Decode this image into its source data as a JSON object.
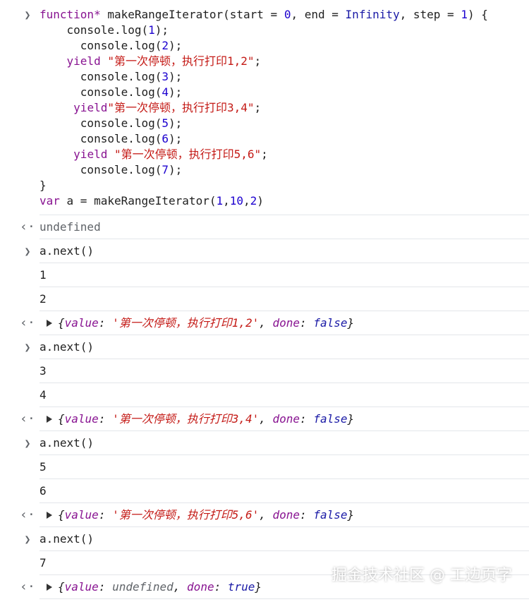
{
  "input1": {
    "lines": [
      {
        "indent": "",
        "parts": [
          [
            "kw",
            "function*"
          ],
          [
            "op",
            " "
          ],
          [
            "fn",
            "makeRangeIterator"
          ],
          [
            "op",
            "("
          ],
          [
            "param",
            "start"
          ],
          [
            "op",
            " = "
          ],
          [
            "num",
            "0"
          ],
          [
            "op",
            ", "
          ],
          [
            "param",
            "end"
          ],
          [
            "op",
            " = "
          ],
          [
            "kw-blue",
            "Infinity"
          ],
          [
            "op",
            ", "
          ],
          [
            "param",
            "step"
          ],
          [
            "op",
            " = "
          ],
          [
            "num",
            "1"
          ],
          [
            "op",
            ") {"
          ]
        ]
      },
      {
        "indent": "    ",
        "parts": [
          [
            "op",
            "console.log("
          ],
          [
            "num",
            "1"
          ],
          [
            "op",
            ");"
          ]
        ]
      },
      {
        "indent": "      ",
        "parts": [
          [
            "op",
            "console.log("
          ],
          [
            "num",
            "2"
          ],
          [
            "op",
            ");"
          ]
        ]
      },
      {
        "indent": "    ",
        "parts": [
          [
            "kw",
            "yield"
          ],
          [
            "op",
            " "
          ],
          [
            "str",
            "\"第一次停顿，执行打印1,2\""
          ],
          [
            "op",
            ";"
          ]
        ]
      },
      {
        "indent": "      ",
        "parts": [
          [
            "op",
            "console.log("
          ],
          [
            "num",
            "3"
          ],
          [
            "op",
            ");"
          ]
        ]
      },
      {
        "indent": "      ",
        "parts": [
          [
            "op",
            "console.log("
          ],
          [
            "num",
            "4"
          ],
          [
            "op",
            ");"
          ]
        ]
      },
      {
        "indent": "     ",
        "parts": [
          [
            "kw",
            "yield"
          ],
          [
            "str",
            "\"第一次停顿，执行打印3,4\""
          ],
          [
            "op",
            ";"
          ]
        ]
      },
      {
        "indent": "      ",
        "parts": [
          [
            "op",
            "console.log("
          ],
          [
            "num",
            "5"
          ],
          [
            "op",
            ");"
          ]
        ]
      },
      {
        "indent": "      ",
        "parts": [
          [
            "op",
            "console.log("
          ],
          [
            "num",
            "6"
          ],
          [
            "op",
            ");"
          ]
        ]
      },
      {
        "indent": "     ",
        "parts": [
          [
            "kw",
            "yield"
          ],
          [
            "op",
            " "
          ],
          [
            "str",
            "\"第一次停顿，执行打印5,6\""
          ],
          [
            "op",
            ";"
          ]
        ]
      },
      {
        "indent": "      ",
        "parts": [
          [
            "op",
            "console.log("
          ],
          [
            "num",
            "7"
          ],
          [
            "op",
            ");"
          ]
        ]
      },
      {
        "indent": "",
        "parts": [
          [
            "op",
            "}"
          ]
        ]
      },
      {
        "indent": "",
        "parts": [
          [
            "kw",
            "var"
          ],
          [
            "op",
            " a = makeRangeIterator("
          ],
          [
            "num",
            "1"
          ],
          [
            "op",
            ","
          ],
          [
            "num",
            "10"
          ],
          [
            "op",
            ","
          ],
          [
            "num",
            "2"
          ],
          [
            "op",
            ")"
          ]
        ]
      }
    ]
  },
  "result_undefined": "undefined",
  "calls": [
    {
      "input": "a.next()",
      "logs": [
        "1",
        "2"
      ],
      "result": {
        "value": "'第一次停顿，执行打印1,2'",
        "done": "false",
        "value_type": "string"
      }
    },
    {
      "input": "a.next()",
      "logs": [
        "3",
        "4"
      ],
      "result": {
        "value": "'第一次停顿，执行打印3,4'",
        "done": "false",
        "value_type": "string"
      }
    },
    {
      "input": "a.next()",
      "logs": [
        "5",
        "6"
      ],
      "result": {
        "value": "'第一次停顿，执行打印5,6'",
        "done": "false",
        "value_type": "string"
      }
    },
    {
      "input": "a.next()",
      "logs": [
        "7"
      ],
      "result": {
        "value": "undefined",
        "done": "true",
        "value_type": "undefined"
      }
    }
  ],
  "labels": {
    "value_key": "value",
    "done_key": "done"
  },
  "icons": {
    "prompt": "chevron-right-icon",
    "return": "return-arrow-icon",
    "expand": "expand-triangle-icon"
  },
  "watermark": "掘金技术社区 @ 工边页字"
}
